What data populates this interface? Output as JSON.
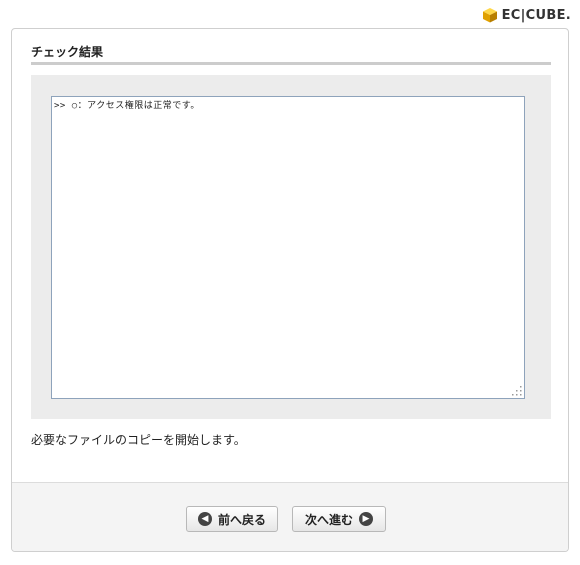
{
  "logo": {
    "text": "EC|CUBE.",
    "brand_color": "#f0b400"
  },
  "page": {
    "title": "チェック結果",
    "log_text": ">> ○：アクセス権限は正常です。",
    "message": "必要なファイルのコピーを開始します。"
  },
  "buttons": {
    "back_label": "前へ戻る",
    "back_icon": "chevron-left-icon",
    "next_label": "次へ進む",
    "next_icon": "chevron-right-icon"
  }
}
